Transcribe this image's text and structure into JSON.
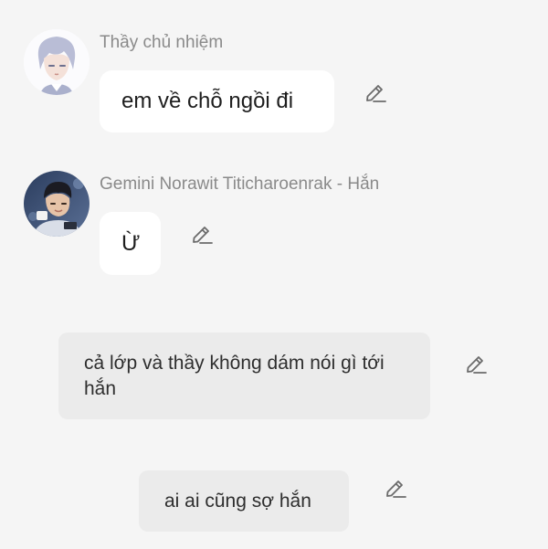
{
  "messages": [
    {
      "sender": "Thầy chủ nhiệm",
      "text": "em về chỗ ngồi đi",
      "avatar_icon": "anime-boy-avatar-icon"
    },
    {
      "sender": "Gemini Norawit Titicharoenrak - Hắn",
      "text": "Ừ",
      "avatar_icon": "person-photo-avatar-icon"
    },
    {
      "text": "cả lớp và thầy không dám nói gì tới hắn"
    },
    {
      "text": "ai ai cũng sợ hắn"
    }
  ],
  "icons": {
    "edit": "pencil-edit-icon"
  },
  "colors": {
    "background": "#f5f5f5",
    "bubble_white": "#ffffff",
    "bubble_gray": "#ebebeb",
    "sender_text": "#8a8a8a",
    "icon": "#6b6b6b"
  }
}
